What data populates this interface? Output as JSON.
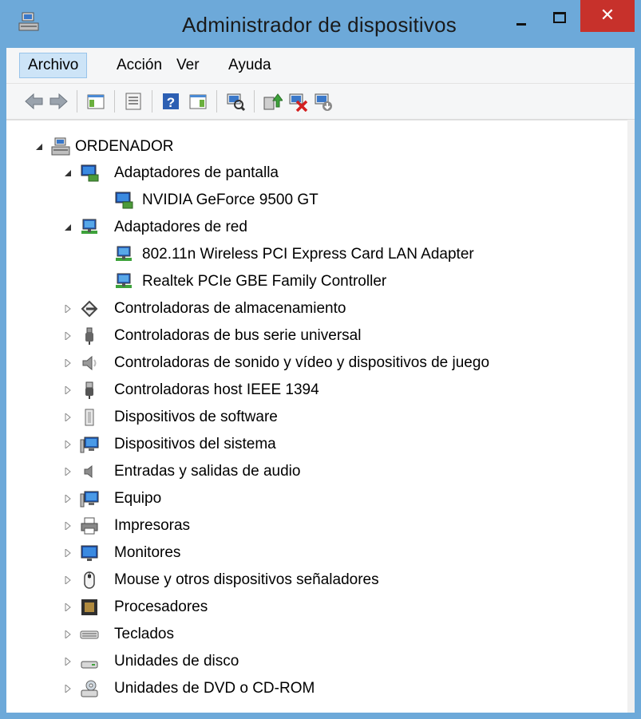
{
  "window": {
    "title": "Administrador de dispositivos",
    "close_glyph": "✕",
    "accent": "#6da9d9",
    "close_color": "#c7312b"
  },
  "menu": {
    "items": [
      "Archivo",
      "Acción",
      "Ver",
      "Ayuda"
    ]
  },
  "toolbar": {
    "buttons": [
      "back-icon",
      "forward-icon",
      "show-hide-console-tree-icon",
      "properties-icon",
      "help-icon",
      "show-hide-action-pane-icon",
      "scan-hardware-icon",
      "update-driver-icon",
      "uninstall-device-icon",
      "disable-device-icon"
    ]
  },
  "tree": {
    "root": "ORDENADOR",
    "nodes": [
      {
        "label": "Adaptadores de pantalla",
        "icon": "display-adapter-icon",
        "expanded": true,
        "children": [
          "NVIDIA GeForce 9500 GT"
        ]
      },
      {
        "label": "Adaptadores de red",
        "icon": "network-adapter-icon",
        "expanded": true,
        "children": [
          "802.11n Wireless PCI Express Card LAN Adapter",
          "Realtek PCIe GBE Family Controller"
        ]
      },
      {
        "label": "Controladoras de almacenamiento",
        "icon": "storage-controller-icon",
        "expanded": false
      },
      {
        "label": "Controladoras de bus serie universal",
        "icon": "usb-icon",
        "expanded": false
      },
      {
        "label": "Controladoras de sonido y vídeo y dispositivos de juego",
        "icon": "speaker-icon",
        "expanded": false
      },
      {
        "label": "Controladoras host IEEE 1394",
        "icon": "firewire-icon",
        "expanded": false
      },
      {
        "label": "Dispositivos de software",
        "icon": "software-device-icon",
        "expanded": false
      },
      {
        "label": "Dispositivos del sistema",
        "icon": "system-device-icon",
        "expanded": false
      },
      {
        "label": "Entradas y salidas de audio",
        "icon": "audio-io-icon",
        "expanded": false
      },
      {
        "label": "Equipo",
        "icon": "computer-icon",
        "expanded": false
      },
      {
        "label": "Impresoras",
        "icon": "printer-icon",
        "expanded": false
      },
      {
        "label": "Monitores",
        "icon": "monitor-icon",
        "expanded": false
      },
      {
        "label": "Mouse y otros dispositivos señaladores",
        "icon": "mouse-icon",
        "expanded": false
      },
      {
        "label": "Procesadores",
        "icon": "processor-icon",
        "expanded": false
      },
      {
        "label": "Teclados",
        "icon": "keyboard-icon",
        "expanded": false
      },
      {
        "label": "Unidades de disco",
        "icon": "disk-drive-icon",
        "expanded": false
      },
      {
        "label": "Unidades de DVD o CD-ROM",
        "icon": "dvd-drive-icon",
        "expanded": false
      }
    ]
  }
}
